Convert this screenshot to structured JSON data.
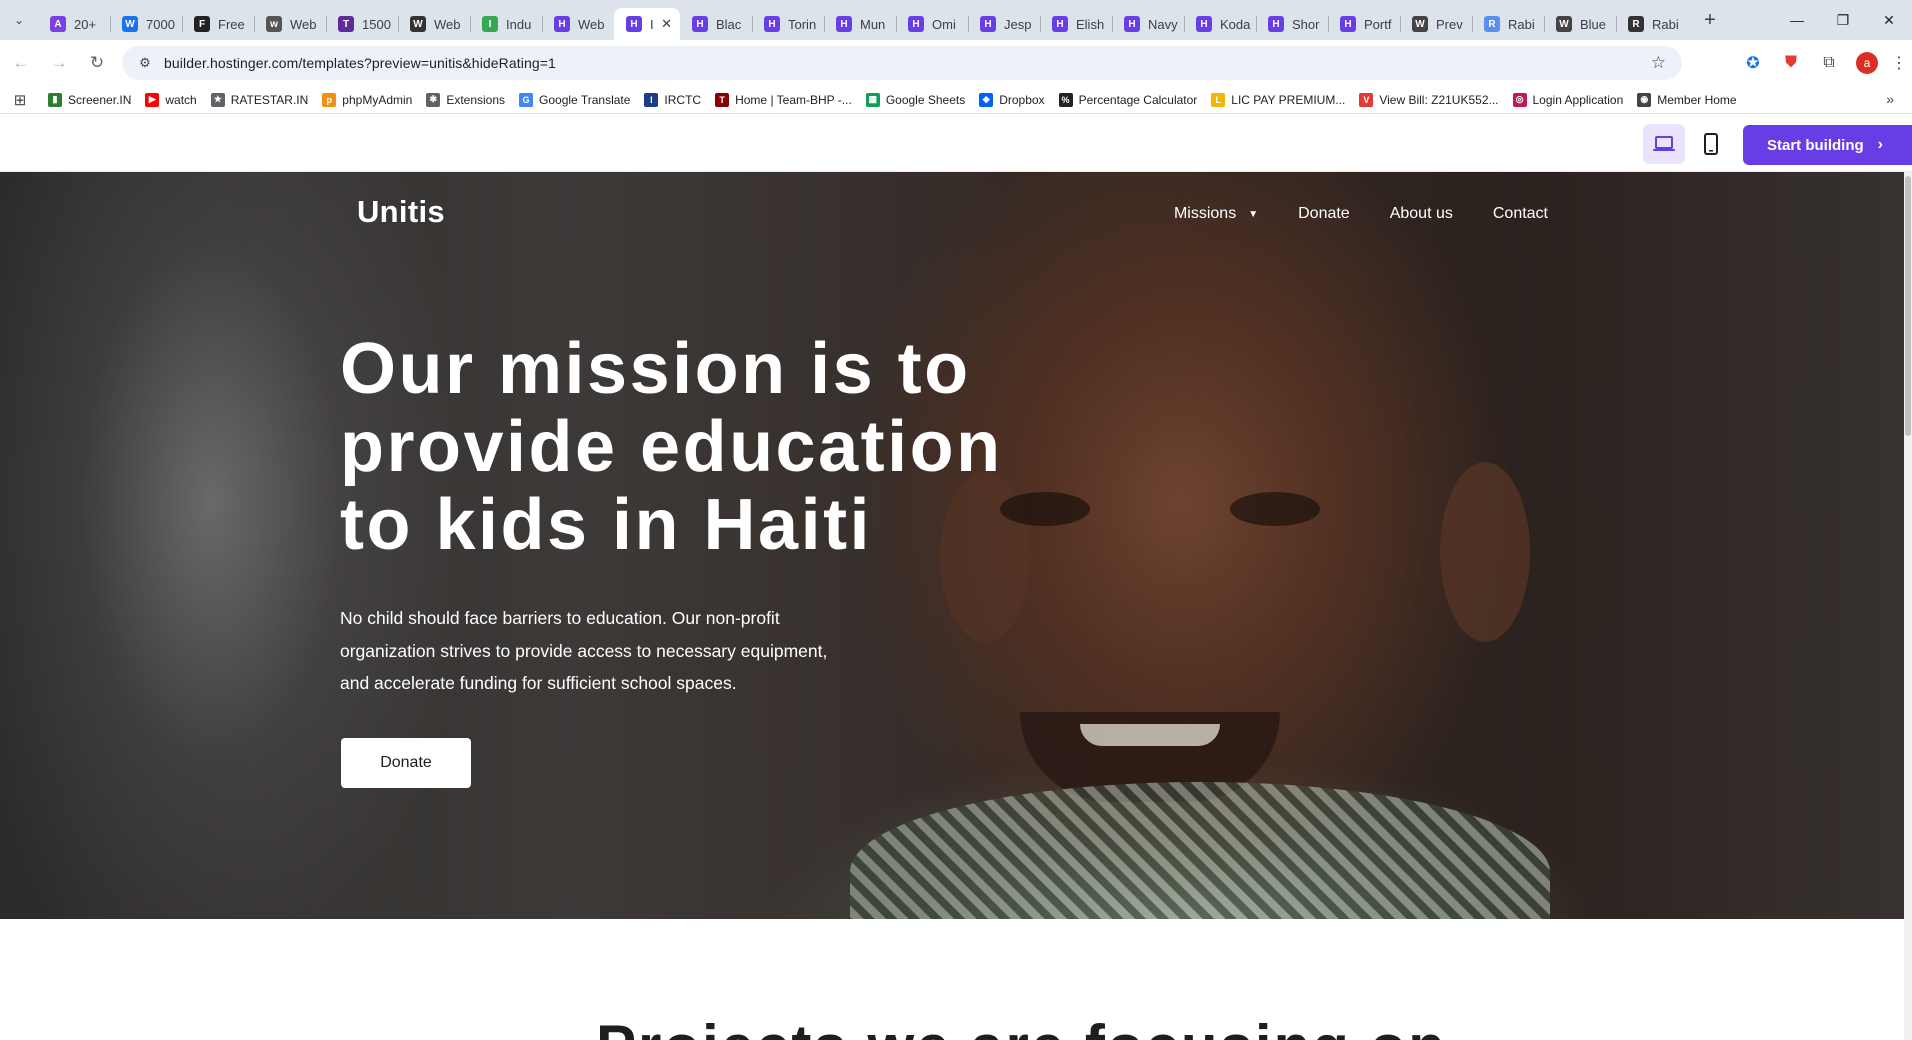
{
  "browser": {
    "tabs": [
      {
        "title": "20+",
        "fav_color": "#7b3fe4",
        "fav_glyph": "A"
      },
      {
        "title": "7000",
        "fav_color": "#1a73e8",
        "fav_glyph": "W"
      },
      {
        "title": "Free",
        "fav_color": "#222222",
        "fav_glyph": "F"
      },
      {
        "title": "Web",
        "fav_color": "#555555",
        "fav_glyph": "w"
      },
      {
        "title": "1500",
        "fav_color": "#5e2b97",
        "fav_glyph": "T"
      },
      {
        "title": "Web",
        "fav_color": "#333333",
        "fav_glyph": "W"
      },
      {
        "title": "Indu",
        "fav_color": "#34a853",
        "fav_glyph": "I"
      },
      {
        "title": "Web",
        "fav_color": "#673de6",
        "fav_glyph": "H"
      },
      {
        "title": "I",
        "fav_color": "#673de6",
        "fav_glyph": "H",
        "active": true
      },
      {
        "title": "Blac",
        "fav_color": "#673de6",
        "fav_glyph": "H"
      },
      {
        "title": "Torin",
        "fav_color": "#673de6",
        "fav_glyph": "H"
      },
      {
        "title": "Mun",
        "fav_color": "#673de6",
        "fav_glyph": "H"
      },
      {
        "title": "Omi",
        "fav_color": "#673de6",
        "fav_glyph": "H"
      },
      {
        "title": "Jesp",
        "fav_color": "#673de6",
        "fav_glyph": "H"
      },
      {
        "title": "Elish",
        "fav_color": "#673de6",
        "fav_glyph": "H"
      },
      {
        "title": "Navy",
        "fav_color": "#673de6",
        "fav_glyph": "H"
      },
      {
        "title": "Koda",
        "fav_color": "#673de6",
        "fav_glyph": "H"
      },
      {
        "title": "Shor",
        "fav_color": "#673de6",
        "fav_glyph": "H"
      },
      {
        "title": "Portf",
        "fav_color": "#673de6",
        "fav_glyph": "H"
      },
      {
        "title": "Prev",
        "fav_color": "#444444",
        "fav_glyph": "W"
      },
      {
        "title": "Rabi",
        "fav_color": "#5b8def",
        "fav_glyph": "R"
      },
      {
        "title": "Blue",
        "fav_color": "#444444",
        "fav_glyph": "W"
      },
      {
        "title": "Rabi",
        "fav_color": "#333333",
        "fav_glyph": "R"
      }
    ],
    "active_close_glyph": "✕",
    "new_tab_glyph": "+",
    "window_controls": {
      "minimize": "—",
      "restore": "❐",
      "close": "✕"
    },
    "url": "builder.hostinger.com/templates?preview=unitis&hideRating=1",
    "back_icon": "←",
    "forward_icon": "→",
    "reload_icon": "↻",
    "profile_initial": "a"
  },
  "bookmarks": [
    {
      "label": "Screener.IN",
      "color": "#2e7d32",
      "glyph": "▮"
    },
    {
      "label": "watch",
      "color": "#ff0000",
      "glyph": "▶"
    },
    {
      "label": "RATESTAR.IN",
      "color": "#5f6368",
      "glyph": "★"
    },
    {
      "label": "phpMyAdmin",
      "color": "#f29111",
      "glyph": "p"
    },
    {
      "label": "Extensions",
      "color": "#5f6368",
      "glyph": "✱"
    },
    {
      "label": "Google Translate",
      "color": "#4285f4",
      "glyph": "G"
    },
    {
      "label": "IRCTC",
      "color": "#1a3c8c",
      "glyph": "I"
    },
    {
      "label": "Home | Team-BHP -...",
      "color": "#8b0000",
      "glyph": "T"
    },
    {
      "label": "Google Sheets",
      "color": "#0f9d58",
      "glyph": "▦"
    },
    {
      "label": "Dropbox",
      "color": "#0061fe",
      "glyph": "◆"
    },
    {
      "label": "Percentage Calculator",
      "color": "#222222",
      "glyph": "%"
    },
    {
      "label": "LIC PAY PREMIUM...",
      "color": "#f2b705",
      "glyph": "L"
    },
    {
      "label": "View Bill: Z21UK552...",
      "color": "#e53935",
      "glyph": "V"
    },
    {
      "label": "Login Application",
      "color": "#c2185b",
      "glyph": "◎"
    },
    {
      "label": "Member Home",
      "color": "#444444",
      "glyph": "◉"
    }
  ],
  "preview_bar": {
    "start_building": "Start building",
    "chevron": "›",
    "accent": "#673de6"
  },
  "site": {
    "logo": "Unitis",
    "nav": {
      "missions": "Missions",
      "donate": "Donate",
      "about": "About us",
      "contact": "Contact"
    },
    "hero_title": "Our mission is to provide education to kids in Haiti",
    "hero_subtitle": "No child should face barriers to education. Our non-profit organization strives to provide access to necessary equipment, and accelerate funding for sufficient school spaces.",
    "hero_button": "Donate",
    "next_section_title_partial": "Projects we are focusing on"
  }
}
